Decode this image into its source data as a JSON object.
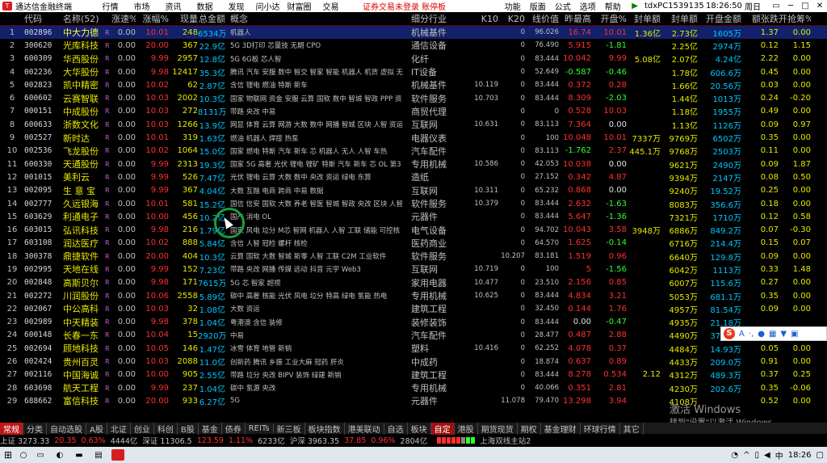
{
  "titlebar": {
    "app_title": "通达信金融终端",
    "menus": [
      "行情",
      "市场",
      "资讯",
      "数据",
      "发现",
      "问小达",
      "财富圈",
      "交易"
    ],
    "warning": "证券交易未登录 账停板",
    "functions": [
      "功能",
      "版面",
      "公式",
      "选项",
      "帮助"
    ],
    "network": "▶",
    "user": "tdxPC1539135",
    "time": "18:26:50",
    "day": "周日",
    "window_buttons": [
      "▭",
      "─",
      "□",
      "✕"
    ]
  },
  "columns": [
    "",
    "代码",
    "名称(52)",
    "",
    "涨速%",
    "涨幅%",
    "现量",
    "总金额",
    "概念",
    "细分行业",
    "K10",
    "K20",
    "线价值",
    "昨最高",
    "开盘%",
    "封单额",
    "封单额",
    "开盘金额",
    "总额",
    "抢筹%"
  ],
  "column_labels": {
    "code": "代码",
    "name": "名称(52)",
    "speed": "涨速%",
    "chg": "涨幅%",
    "vol": "现量",
    "amt": "总金额",
    "concept": "概念",
    "industry": "细分行业",
    "k10": "K10",
    "k20": "K20",
    "line": "线价值",
    "yh": "昨最高",
    "open": "开盘%",
    "seal_buy": "封单额",
    "seal_amt": "封单额",
    "open_amt": "开盘金额",
    "p1": "额张跌",
    "p2": "开抢筹%"
  },
  "rows": [
    {
      "idx": "1",
      "code": "002896",
      "name": "中大力德",
      "flag": "R",
      "spd": "0.00",
      "chg": "10.01",
      "vol": "248",
      "amt": "6534万",
      "con": "机器人",
      "ind": "机械基件",
      "k10": "",
      "k20": "0",
      "line": "96.026",
      "yh": "16.74",
      "op": "10.01",
      "sb": "1.36亿",
      "sa": "2.73亿",
      "oa": "1605万",
      "p1": "1.37",
      "p2": "0.00",
      "sel": true
    },
    {
      "idx": "2",
      "code": "300620",
      "name": "光库科技",
      "flag": "R",
      "spd": "0.00",
      "chg": "20.00",
      "vol": "367",
      "amt": "22.9亿",
      "con": "5G 3D打印 芯量技 无期 CPO",
      "ind": "通信设备",
      "k10": "",
      "k20": "0",
      "line": "76.490",
      "yh": "5.915",
      "op": "-1.81",
      "sb": "",
      "sa": "2.25亿",
      "oa": "2974万",
      "p1": "0.12",
      "p2": "1.15"
    },
    {
      "idx": "3",
      "code": "600309",
      "name": "华西股份",
      "flag": "R",
      "spd": "0.00",
      "chg": "9.99",
      "vol": "2957",
      "amt": "12.8亿",
      "con": "5G 6G板 芯人智",
      "ind": "化纤",
      "k10": "",
      "k20": "0",
      "line": "83.444",
      "yh": "10.042",
      "op": "9.99",
      "sb": "5.08亿",
      "sa": "2.07亿",
      "oa": "4.24亿",
      "p1": "2.22",
      "p2": "0.00"
    },
    {
      "idx": "4",
      "code": "002236",
      "name": "大华股份",
      "flag": "R",
      "spd": "0.00",
      "chg": "9.98",
      "vol": "12417",
      "amt": "35.3亿",
      "con": "腾讯 汽车 安服 数中 智交 智家 智能 机器人 机货 虚拟 无",
      "ind": "IT设备",
      "k10": "",
      "k20": "0",
      "line": "52.649",
      "yh": "-0.587",
      "op": "-0.46",
      "sb": "",
      "sa": "1.78亿",
      "oa": "606.6万",
      "p1": "0.45",
      "p2": "0.00"
    },
    {
      "idx": "5",
      "code": "002823",
      "name": "凯中精密",
      "flag": "R",
      "spd": "0.00",
      "chg": "10.02",
      "vol": "62",
      "amt": "2.87亿",
      "con": "含信 锂电 燃油 特斯 新车",
      "ind": "机械基件",
      "k10": "10.119",
      "k20": "0",
      "line": "83.444",
      "yh": "0.372",
      "op": "0.28",
      "sb": "",
      "sa": "1.66亿",
      "oa": "20.56万",
      "p1": "0.03",
      "p2": "0.00"
    },
    {
      "idx": "6",
      "code": "600602",
      "name": "云赛智联",
      "flag": "R",
      "spd": "0.00",
      "chg": "10.03",
      "vol": "2002",
      "amt": "10.3亿",
      "con": "国家 物联网 资金 安服 云算 国软 数中 智城 智政 PPP 资",
      "ind": "软件服务",
      "k10": "10.703",
      "k20": "0",
      "line": "83.444",
      "yh": "8.309",
      "op": "-2.03",
      "sb": "",
      "sa": "1.44亿",
      "oa": "1013万",
      "p1": "0.24",
      "p2": "-0.20"
    },
    {
      "idx": "7",
      "code": "000151",
      "name": "中成股份",
      "flag": "R",
      "spd": "0.00",
      "chg": "10.03",
      "vol": "272",
      "amt": "8131万",
      "con": "带路 央改 中易",
      "ind": "商贸代理",
      "k10": "",
      "k20": "0",
      "line": "0",
      "yh": "0.528",
      "op": "10.03",
      "sb": "",
      "sa": "1.18亿",
      "oa": "1955万",
      "p1": "0.49",
      "p2": "0.00"
    },
    {
      "idx": "8",
      "code": "600633",
      "name": "浙数文化",
      "flag": "R",
      "spd": "0.00",
      "chg": "10.03",
      "vol": "1266",
      "amt": "13.9亿",
      "con": "网显 体育 云算 网游 大数 数中 网播 智城 区块 人智 资运",
      "ind": "互联网",
      "k10": "10.631",
      "k20": "0",
      "line": "83.113",
      "yh": "7.364",
      "op": "0.00",
      "sb": "",
      "sa": "1.13亿",
      "oa": "1126万",
      "p1": "0.09",
      "p2": "0.97"
    },
    {
      "idx": "9",
      "code": "002527",
      "name": "新时达",
      "flag": "R",
      "spd": "0.00",
      "chg": "10.01",
      "vol": "319",
      "amt": "1.63亿",
      "con": "燃油 机器人 焊接 热泵",
      "ind": "电器仪表",
      "k10": "",
      "k20": "0",
      "line": "100",
      "yh": "10.048",
      "op": "10.01",
      "sb": "7337万",
      "sa": "9769万",
      "oa": "6502万",
      "p1": "0.35",
      "p2": "0.00"
    },
    {
      "idx": "10",
      "code": "002536",
      "name": "飞龙股份",
      "flag": "R",
      "spd": "0.00",
      "chg": "10.02",
      "vol": "1064",
      "amt": "15.0亿",
      "con": "国家 燃电 特斯 汽车 新车 芯 机器人 无人 人智 车热",
      "ind": "汽车配件",
      "k10": "",
      "k20": "0",
      "line": "83.113",
      "yh": "-1.762",
      "op": "2.37",
      "sb": "445.1万",
      "sa": "9768万",
      "oa": "2503万",
      "p1": "0.11",
      "p2": "0.00"
    },
    {
      "idx": "11",
      "code": "600330",
      "name": "天通股份",
      "flag": "R",
      "spd": "0.00",
      "chg": "9.99",
      "vol": "2313",
      "amt": "19.3亿",
      "con": "国家 5G 高奢 光伏 锂电 锂矿 特斯 汽车 新车 芯 OL 第3",
      "ind": "专用机械",
      "k10": "10.586",
      "k20": "0",
      "line": "42.053",
      "yh": "10.038",
      "op": "0.00",
      "sb": "",
      "sa": "9621万",
      "oa": "2490万",
      "p1": "0.09",
      "p2": "1.87"
    },
    {
      "idx": "12",
      "code": "001015",
      "name": "美利云",
      "flag": "R",
      "spd": "0.00",
      "chg": "9.99",
      "vol": "526",
      "amt": "7.47亿",
      "con": "光伏 锂电 云算 大数 数中 央改 资运 绿电 东算",
      "ind": "造纸",
      "k10": "",
      "k20": "0",
      "line": "27.152",
      "yh": "0.342",
      "op": "4.87",
      "sb": "",
      "sa": "9394万",
      "oa": "2147万",
      "p1": "0.08",
      "p2": "0.50"
    },
    {
      "idx": "13",
      "code": "002095",
      "name": "生 意 宝",
      "flag": "R",
      "spd": "0.00",
      "chg": "9.99",
      "vol": "367",
      "amt": "4.04亿",
      "con": "大数 互融 电商 跨商 中易 数据",
      "ind": "互联网",
      "k10": "10.311",
      "k20": "0",
      "line": "65.232",
      "yh": "0.868",
      "op": "0.00",
      "sb": "",
      "sa": "9240万",
      "oa": "19.52万",
      "p1": "0.25",
      "p2": "0.00"
    },
    {
      "idx": "14",
      "code": "002777",
      "name": "久远银海",
      "flag": "R",
      "spd": "0.00",
      "chg": "10.01",
      "vol": "581",
      "amt": "15.2亿",
      "con": "国信 信安 国软 大数 养老 智医 智城 智政 央改 区块 人智",
      "ind": "软件服务",
      "k10": "10.379",
      "k20": "0",
      "line": "83.444",
      "yh": "2.632",
      "op": "-1.63",
      "sb": "",
      "sa": "8083万",
      "oa": "356.6万",
      "p1": "0.18",
      "p2": "0.00"
    },
    {
      "idx": "15",
      "code": "603629",
      "name": "利通电子",
      "flag": "R",
      "spd": "0.00",
      "chg": "10.00",
      "vol": "456",
      "amt": "10.2亿",
      "con": "国产 消电 OL",
      "ind": "元器件",
      "k10": "",
      "k20": "0",
      "line": "83.444",
      "yh": "5.647",
      "op": "-1.36",
      "sb": "",
      "sa": "7321万",
      "oa": "1710万",
      "p1": "0.12",
      "p2": "0.58"
    },
    {
      "idx": "16",
      "code": "603015",
      "name": "弘讯科技",
      "flag": "R",
      "spd": "0.00",
      "chg": "9.98",
      "vol": "216",
      "amt": "1.79亿",
      "con": "国家 风电 垃分 M芯 智网 机器人 人智 工联 储能 可控核",
      "ind": "电气设备",
      "k10": "",
      "k20": "0",
      "line": "94.702",
      "yh": "10.043",
      "op": "3.58",
      "sb": "3948万",
      "sa": "6886万",
      "oa": "849.2万",
      "p1": "0.07",
      "p2": "-0.30"
    },
    {
      "idx": "17",
      "code": "603108",
      "name": "润达医疗",
      "flag": "R",
      "spd": "0.00",
      "chg": "10.02",
      "vol": "888",
      "amt": "5.84亿",
      "con": "含信 人智 冠检 螺杆 核检",
      "ind": "医药商业",
      "k10": "",
      "k20": "0",
      "line": "64.570",
      "yh": "1.625",
      "op": "-0.14",
      "sb": "",
      "sa": "6716万",
      "oa": "214.4万",
      "p1": "0.15",
      "p2": "0.07"
    },
    {
      "idx": "18",
      "code": "300378",
      "name": "鼎捷软件",
      "flag": "R",
      "spd": "0.00",
      "chg": "20.00",
      "vol": "404",
      "amt": "10.3亿",
      "con": "云算 国软 大数 智城 新零 人智 工联 C2M 工业软件",
      "ind": "软件服务",
      "k10": "",
      "k20": "10.207",
      "line": "83.181",
      "yh": "1.519",
      "op": "0.96",
      "sb": "",
      "sa": "6640万",
      "oa": "129.8万",
      "p1": "0.09",
      "p2": "0.00"
    },
    {
      "idx": "19",
      "code": "002995",
      "name": "天地在线",
      "flag": "R",
      "spd": "0.00",
      "chg": "9.99",
      "vol": "152",
      "amt": "7.23亿",
      "con": "带路 央改 网播 传媒 远动 抖音 元宇 Web3",
      "ind": "互联网",
      "k10": "10.719",
      "k20": "0",
      "line": "100",
      "yh": "5",
      "op": "-1.56",
      "sb": "",
      "sa": "6042万",
      "oa": "1113万",
      "p1": "0.33",
      "p2": "1.48"
    },
    {
      "idx": "20",
      "code": "002848",
      "name": "高斯贝尔",
      "flag": "R",
      "spd": "0.00",
      "chg": "9.98",
      "vol": "171",
      "amt": "7615万",
      "con": "5G 芯 智家 超视",
      "ind": "家用电器",
      "k10": "10.477",
      "k20": "0",
      "line": "23.510",
      "yh": "2.156",
      "op": "0.85",
      "sb": "",
      "sa": "6007万",
      "oa": "115.6万",
      "p1": "0.27",
      "p2": "0.00"
    },
    {
      "idx": "21",
      "code": "002272",
      "name": "川润股份",
      "flag": "R",
      "spd": "0.00",
      "chg": "10.06",
      "vol": "2558",
      "amt": "5.89亿",
      "con": "碳中 高奢 核能 光伏 风电 垃分 特高 绿电 氢能 热电",
      "ind": "专用机械",
      "k10": "10.625",
      "k20": "0",
      "line": "83.444",
      "yh": "4.834",
      "op": "3.21",
      "sb": "",
      "sa": "5053万",
      "oa": "681.1万",
      "p1": "0.35",
      "p2": "0.00"
    },
    {
      "idx": "22",
      "code": "002067",
      "name": "中公高科",
      "flag": "R",
      "spd": "0.00",
      "chg": "10.03",
      "vol": "32",
      "amt": "1.08亿",
      "con": "大数 资运",
      "ind": "建筑工程",
      "k10": "",
      "k20": "0",
      "line": "32.450",
      "yh": "0.144",
      "op": "1.76",
      "sb": "",
      "sa": "4957万",
      "oa": "81.54万",
      "p1": "0.09",
      "p2": "0.00"
    },
    {
      "idx": "23",
      "code": "002989",
      "name": "中天精装",
      "flag": "R",
      "spd": "0.00",
      "chg": "9.98",
      "vol": "378",
      "amt": "1.04亿",
      "con": "粤港澳 含信 装修",
      "ind": "装修装饰",
      "k10": "",
      "k20": "0",
      "line": "83.444",
      "yh": "0.00",
      "op": "-0.47",
      "sb": "",
      "sa": "4935万",
      "oa": "21.18万",
      "p1": "",
      "p2": ""
    },
    {
      "idx": "24",
      "code": "600148",
      "name": "长春一东",
      "flag": "R",
      "spd": "0.00",
      "chg": "10.04",
      "vol": "15",
      "amt": "2920万",
      "con": "中易",
      "ind": "汽车配件",
      "k10": "",
      "k20": "0",
      "line": "28.477",
      "yh": "0.487",
      "op": "2.88",
      "sb": "",
      "sa": "4490万",
      "oa": "37.09万",
      "p1": "",
      "p2": ""
    },
    {
      "idx": "25",
      "code": "002694",
      "name": "顾地科技",
      "flag": "R",
      "spd": "0.00",
      "chg": "10.05",
      "vol": "146",
      "amt": "1.47亿",
      "con": "冰雪 体育 地管 新销",
      "ind": "塑料",
      "k10": "10.416",
      "k20": "0",
      "line": "62.252",
      "yh": "4.078",
      "op": "0.37",
      "sb": "",
      "sa": "4484万",
      "oa": "14.93万",
      "p1": "0.05",
      "p2": "0.00"
    },
    {
      "idx": "26",
      "code": "002424",
      "name": "贵州百灵",
      "flag": "R",
      "spd": "0.00",
      "chg": "10.03",
      "vol": "2088",
      "amt": "11.0亿",
      "con": "创新药 腾讯 乡振 工业大麻 冠药 肝炎",
      "ind": "中成药",
      "k10": "",
      "k20": "0",
      "line": "18.874",
      "yh": "0.637",
      "op": "0.89",
      "sb": "",
      "sa": "4433万",
      "oa": "209.0万",
      "p1": "0.91",
      "p2": "0.00"
    },
    {
      "idx": "27",
      "code": "002116",
      "name": "中国海诚",
      "flag": "R",
      "spd": "0.00",
      "chg": "10.00",
      "vol": "905",
      "amt": "2.55亿",
      "con": "带路 垃分 央改 BIPV 装饰 绿建 新销",
      "ind": "建筑工程",
      "k10": "",
      "k20": "0",
      "line": "83.444",
      "yh": "8.278",
      "op": "0.534",
      "sb": "2.12",
      "sa": "4312万",
      "oa": "489.3万",
      "p1": "0.37",
      "p2": "0.25"
    },
    {
      "idx": "28",
      "code": "603698",
      "name": "航天工程",
      "flag": "R",
      "spd": "0.00",
      "chg": "9.99",
      "vol": "237",
      "amt": "1.04亿",
      "con": "碳中 氢源 央改",
      "ind": "专用机械",
      "k10": "",
      "k20": "0",
      "line": "40.066",
      "yh": "0.351",
      "op": "2.81",
      "sb": "",
      "sa": "4230万",
      "oa": "202.6万",
      "p1": "0.35",
      "p2": "-0.06"
    },
    {
      "idx": "29",
      "code": "688662",
      "name": "富信科技",
      "flag": "R",
      "spd": "0.00",
      "chg": "20.00",
      "vol": "933",
      "amt": "6.27亿",
      "con": "5G",
      "ind": "元器件",
      "k10": "",
      "k20": "11.078",
      "line": "79.470",
      "yh": "13.298",
      "op": "3.94",
      "sb": "",
      "sa": "4108万",
      "oa": "",
      "p1": "0.52",
      "p2": "0.00"
    }
  ],
  "tabs": [
    "常规",
    "分类",
    "自动选股",
    "A股",
    "北证",
    "创业",
    "科创",
    "B股",
    "基金",
    "债券",
    "REITs",
    "新三板",
    "板块指数",
    "港美联动",
    "自选",
    "板块",
    "自定",
    "港股",
    "期货现货",
    "期权",
    "基金理财",
    "环球行情",
    "其它"
  ],
  "status": {
    "sh": "上证 3273.33",
    "sh_chg": "20.35",
    "sh_pct": "0.63%",
    "sh_amt": "4444亿",
    "sz": "深证 11306.5",
    "sz_chg": "123.59",
    "sz_pct": "1.11%",
    "sz_amt": "6233亿",
    "hs": "沪深 3963.35",
    "hs_chg": "37.85",
    "hs_pct": "0.96%",
    "hs_amt": "2804亿",
    "station": "上海双线主站2"
  },
  "taskbar": {
    "time": "18:26",
    "ime": "中"
  },
  "ime_bar": {
    "logo": "S",
    "items": [
      "A",
      "·,",
      "mic",
      "keyboard",
      "shirt",
      "grid"
    ]
  },
  "watermark": {
    "line1": "激活 Windows",
    "line2": "转到\"设置\"以激活 Windows。"
  },
  "colors": {
    "up": "#ff3030",
    "down": "#30ff30",
    "name": "#e8e800",
    "amount": "#00c8ff",
    "selected": "#13206a",
    "tab_active": "#c01818"
  }
}
